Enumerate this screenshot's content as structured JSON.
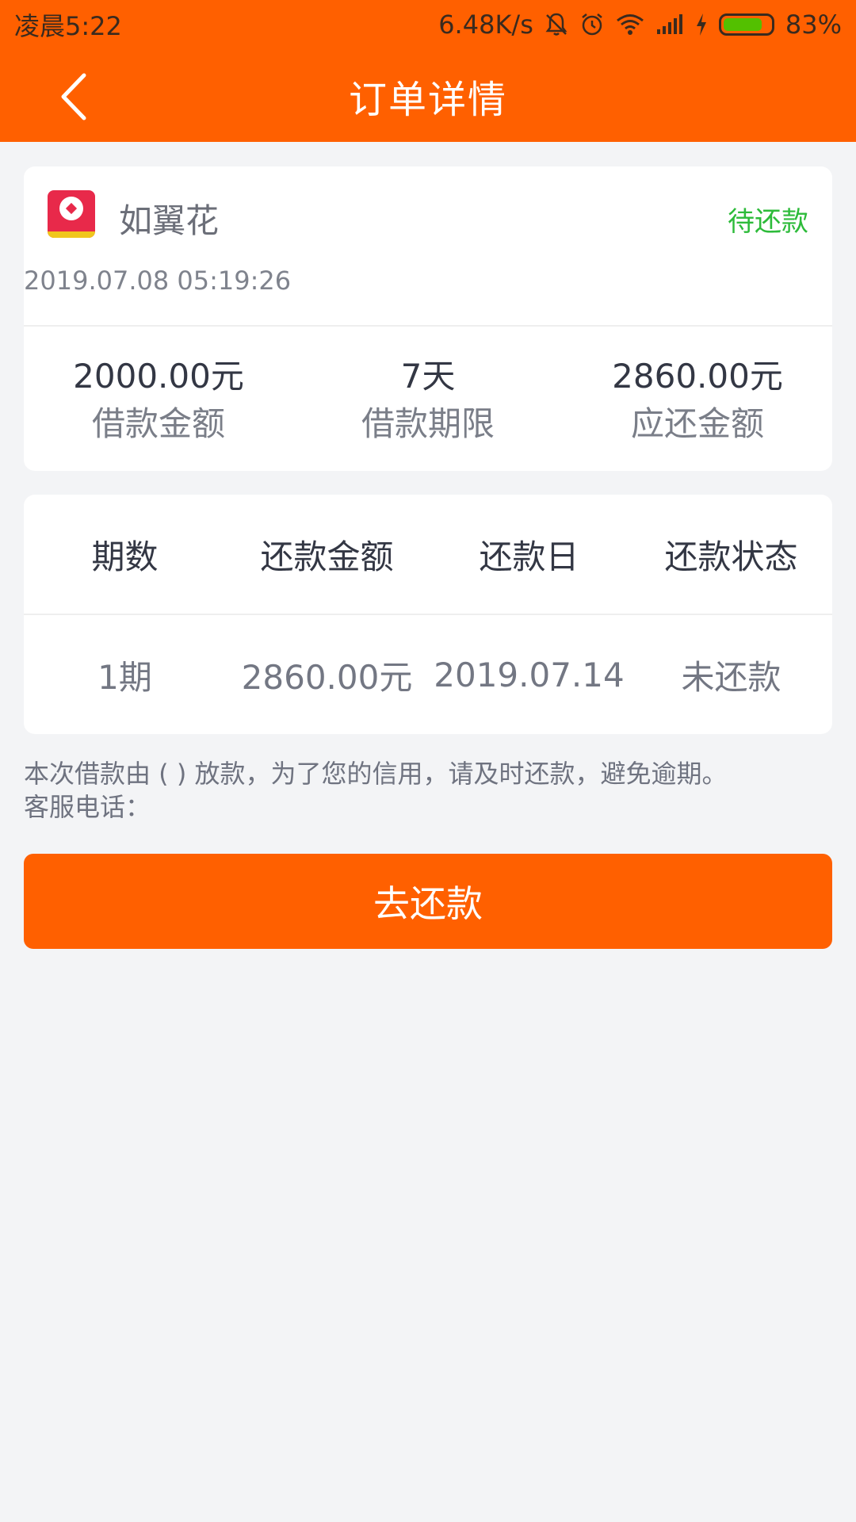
{
  "status_bar": {
    "time": "凌晨5:22",
    "network_speed": "6.48K/s",
    "battery_percent_text": "83%",
    "battery_level": 0.83,
    "icons": [
      "mute-bell-icon",
      "alarm-icon",
      "wifi-icon",
      "signal-icon",
      "charging-icon",
      "battery-icon"
    ]
  },
  "header": {
    "title": "订单详情",
    "back_icon": "chevron-left-icon"
  },
  "order": {
    "merchant_name": "如翼花",
    "logo_text": "如翼花",
    "status": "待还款",
    "created_at": "2019.07.08 05:19:26",
    "summary": [
      {
        "value": "2000.00元",
        "label": "借款金额"
      },
      {
        "value": "7天",
        "label": "借款期限"
      },
      {
        "value": "2860.00元",
        "label": "应还金额"
      }
    ]
  },
  "schedule": {
    "headers": [
      "期数",
      "还款金额",
      "还款日",
      "还款状态"
    ],
    "rows": [
      [
        "1期",
        "2860.00元",
        "2019.07.14",
        "未还款"
      ]
    ]
  },
  "notice": {
    "line1": "本次借款由 ( ) 放款，为了您的信用，请及时还款，避免逾期。",
    "line2": "客服电话："
  },
  "actions": {
    "repay_label": "去还款"
  },
  "colors": {
    "brand": "#ff6000",
    "status_pending": "#2dbb3a",
    "background": "#f3f4f6"
  }
}
